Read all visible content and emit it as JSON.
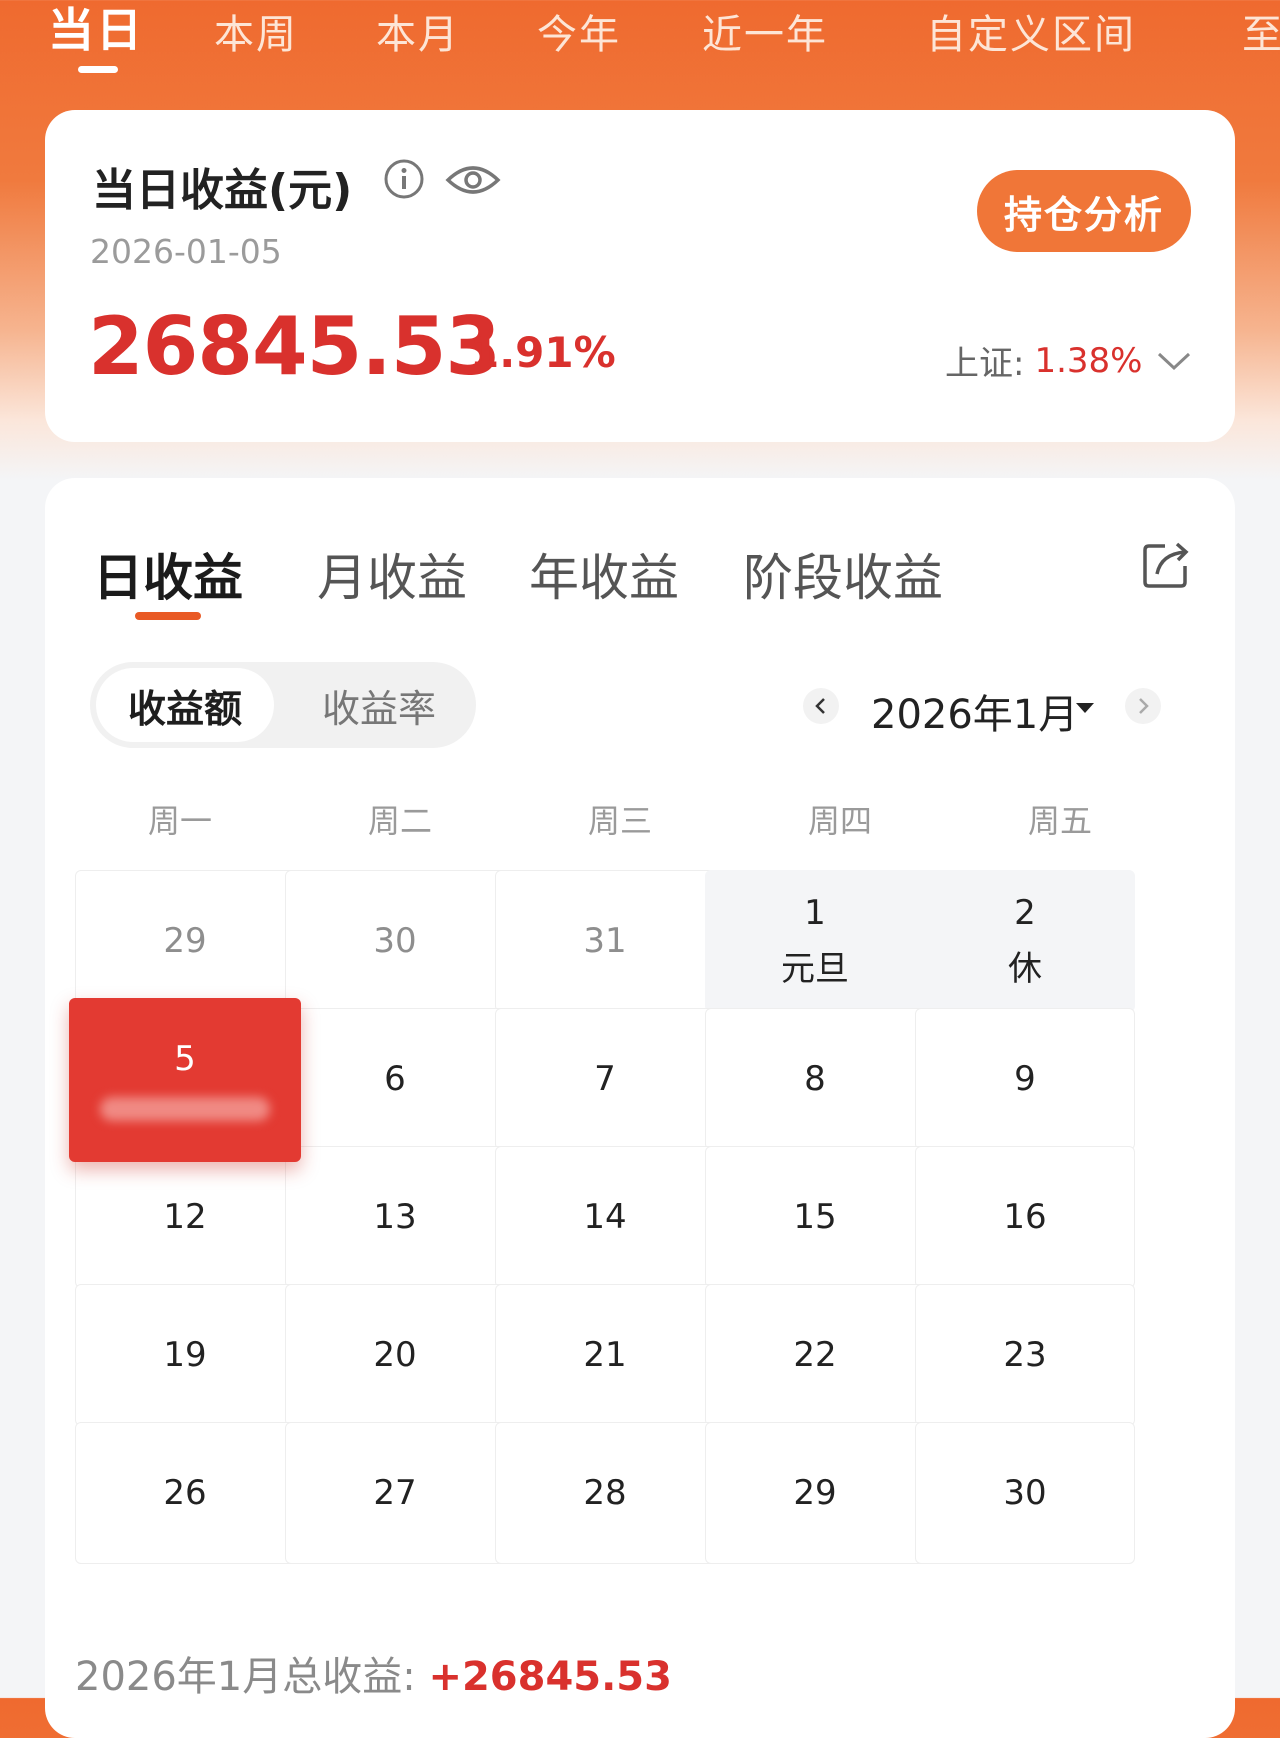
{
  "top_tabs": [
    "当日",
    "本周",
    "本月",
    "今年",
    "近一年",
    "自定义区间",
    "至"
  ],
  "summary": {
    "title": "当日收益(元)",
    "date": "2026-01-05",
    "amount": "26845.53",
    "percent": "1.91%",
    "holdings_button": "持仓分析",
    "index_label": "上证:",
    "index_value": "1.38%"
  },
  "sub_tabs": [
    "日收益",
    "月收益",
    "年收益",
    "阶段收益"
  ],
  "toggle": {
    "active": "收益额",
    "inactive": "收益率"
  },
  "month_label": "2026年1月",
  "weekdays": [
    "周一",
    "周二",
    "周三",
    "周四",
    "周五"
  ],
  "calendar": [
    [
      {
        "day": "29",
        "muted": true
      },
      {
        "day": "30",
        "muted": true
      },
      {
        "day": "31",
        "muted": true
      },
      {
        "day": "1",
        "note": "元旦",
        "holiday": true
      },
      {
        "day": "2",
        "note": "休",
        "holiday": true
      }
    ],
    [
      {
        "day": "5",
        "selected": true
      },
      {
        "day": "6"
      },
      {
        "day": "7"
      },
      {
        "day": "8"
      },
      {
        "day": "9"
      }
    ],
    [
      {
        "day": "12"
      },
      {
        "day": "13"
      },
      {
        "day": "14"
      },
      {
        "day": "15"
      },
      {
        "day": "16"
      }
    ],
    [
      {
        "day": "19"
      },
      {
        "day": "20"
      },
      {
        "day": "21"
      },
      {
        "day": "22"
      },
      {
        "day": "23"
      }
    ],
    [
      {
        "day": "26"
      },
      {
        "day": "27"
      },
      {
        "day": "28"
      },
      {
        "day": "29"
      },
      {
        "day": "30"
      }
    ]
  ],
  "footer": {
    "label": "2026年1月总收益: ",
    "value": "+26845.53"
  },
  "colors": {
    "brand_orange": "#ef6a2f",
    "profit_red": "#d9312d",
    "selected_red": "#e33a32",
    "tab_underline": "#e95a25"
  },
  "icons": [
    "info-icon",
    "eye-icon",
    "chevron-down-icon",
    "share-icon",
    "chevron-left-icon",
    "chevron-right-icon",
    "caret-down-icon"
  ]
}
